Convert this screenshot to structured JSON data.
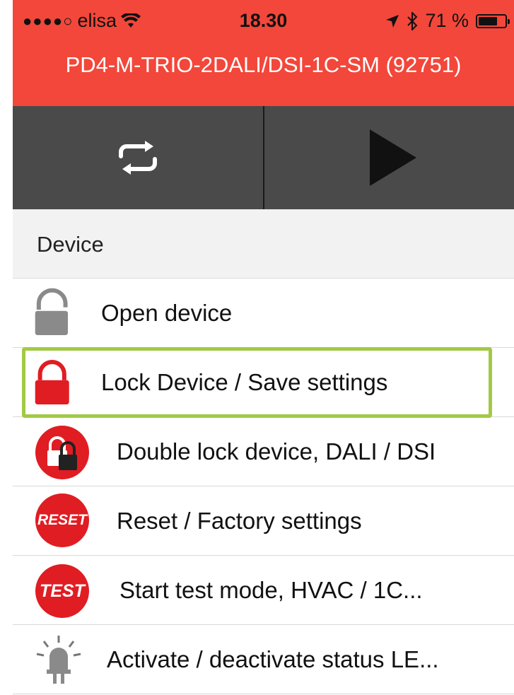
{
  "status_bar": {
    "signal": "●●●●○",
    "carrier": "elisa",
    "time": "18.30",
    "battery_text": "71 %",
    "battery_level": 0.71
  },
  "header": {
    "title": "PD4-M-TRIO-2DALI/DSI-1C-SM  (92751)"
  },
  "toolbar": {
    "buttons": [
      {
        "name": "sync",
        "icon": "repeat-icon"
      },
      {
        "name": "run",
        "icon": "play-icon"
      }
    ]
  },
  "section": {
    "title": "Device"
  },
  "items": [
    {
      "label": "Open device",
      "icon": "unlocked-padlock-icon"
    },
    {
      "label": "Lock Device / Save settings",
      "icon": "locked-padlock-icon"
    },
    {
      "label": "Double lock device, DALI / DSI",
      "icon": "double-lock-icon"
    },
    {
      "label": "Reset / Factory settings",
      "icon": "reset-badge-icon",
      "badge_text": "RESET"
    },
    {
      "label": "Start test mode, HVAC / 1C...",
      "icon": "test-badge-icon",
      "badge_text": "TEST"
    },
    {
      "label": "Activate / deactivate status LE...",
      "icon": "status-led-icon"
    }
  ],
  "colors": {
    "header_bg": "#f2473a",
    "toolbar_bg": "#4a4a4a",
    "highlight": "#a3c945",
    "badge_red": "#e01d23"
  }
}
